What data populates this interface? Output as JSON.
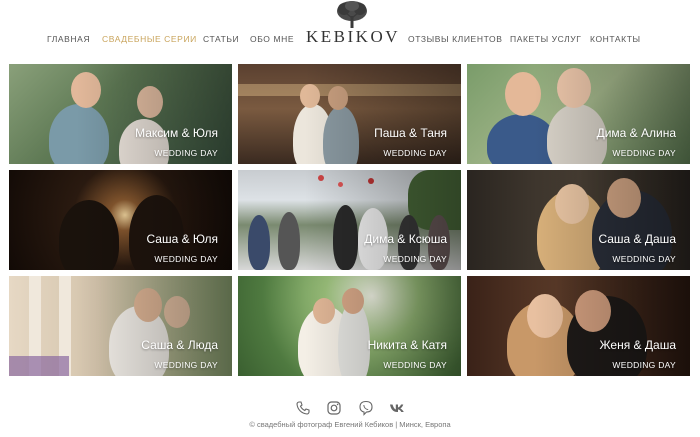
{
  "nav": {
    "left": [
      "ГЛАВНАЯ",
      "СВАДЕБНЫЕ СЕРИИ",
      "СТАТЬИ",
      "ОБО МНЕ"
    ],
    "right": [
      "ОТЗЫВЫ КЛИЕНТОВ",
      "ПАКЕТЫ УСЛУГ",
      "КОНТАКТЫ"
    ],
    "active_index": 1,
    "active_color": "#c9a45c"
  },
  "logo": {
    "text": "KEBIKOV"
  },
  "gallery": [
    {
      "title": "Максим & Юля",
      "subtitle": "WEDDING DAY"
    },
    {
      "title": "Паша & Таня",
      "subtitle": "WEDDING DAY"
    },
    {
      "title": "Дима & Алина",
      "subtitle": "WEDDING DAY"
    },
    {
      "title": "Саша & Юля",
      "subtitle": "WEDDING DAY"
    },
    {
      "title": "Дима & Ксюша",
      "subtitle": "WEDDING DAY"
    },
    {
      "title": "Саша & Даша",
      "subtitle": "WEDDING DAY"
    },
    {
      "title": "Саша & Люда",
      "subtitle": "WEDDING DAY"
    },
    {
      "title": "Никита & Катя",
      "subtitle": "WEDDING DAY"
    },
    {
      "title": "Женя & Даша",
      "subtitle": "WEDDING DAY"
    }
  ],
  "social": [
    "phone-icon",
    "instagram-icon",
    "viber-icon",
    "vk-icon"
  ],
  "footer": {
    "copyright": "© свадебный фотограф Евгений Кебиков | Минск, Европа"
  }
}
